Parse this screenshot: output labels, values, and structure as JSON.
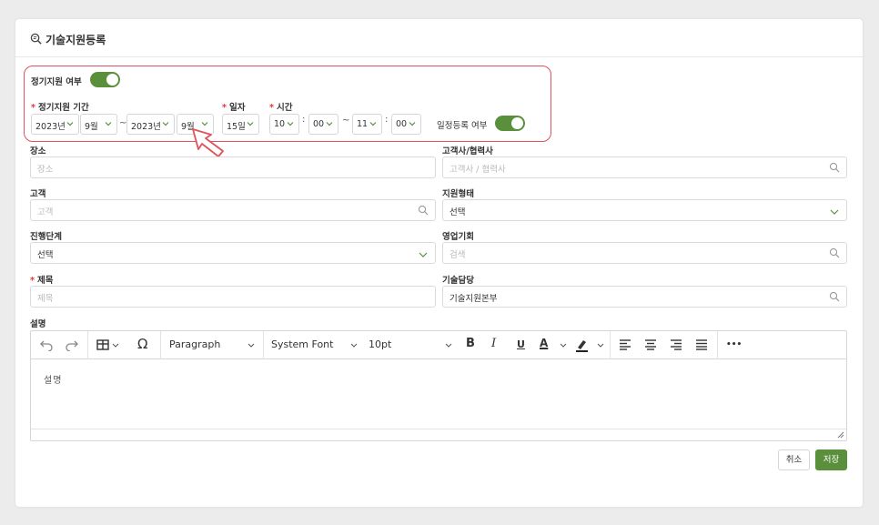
{
  "header": {
    "title": "기술지원등록"
  },
  "schedule": {
    "regular_label": "정기지원 여부",
    "period_label": "정기지원 기간",
    "day_label": "일자",
    "time_label": "시간",
    "start_year": "2023년",
    "start_month": "9월",
    "tilde": "~",
    "end_year": "2023년",
    "end_month": "9월",
    "day": "15일",
    "start_hour": "10",
    "start_minute": "00",
    "end_hour": "11",
    "end_minute": "00",
    "colon": ":",
    "register_label": "일정등록 여부"
  },
  "form": {
    "place_label": "장소",
    "place_placeholder": "장소",
    "partner_label": "고객사/협력사",
    "partner_placeholder": "고객사 / 협력사",
    "customer_label": "고객",
    "customer_placeholder": "고객",
    "support_type_label": "지원형태",
    "support_type_value": "선택",
    "stage_label": "진행단계",
    "stage_value": "선택",
    "opportunity_label": "영업기회",
    "opportunity_placeholder": "검색",
    "title_label": "제목",
    "title_placeholder": "제목",
    "manager_label": "기술담당",
    "manager_value": "기술지원본부",
    "desc_label": "설명"
  },
  "editor": {
    "paragraph": "Paragraph",
    "font": "System Font",
    "size": "10pt",
    "bold": "B",
    "italic": "I",
    "underline": "U",
    "font_color": "A",
    "more": "•••",
    "omega": "Ω",
    "content": "설명"
  },
  "buttons": {
    "cancel": "취소",
    "save": "저장"
  },
  "required_mark": "*",
  "colors": {
    "accent": "#5a8f3c",
    "highlight": "#e0525c",
    "required": "#e53935"
  }
}
